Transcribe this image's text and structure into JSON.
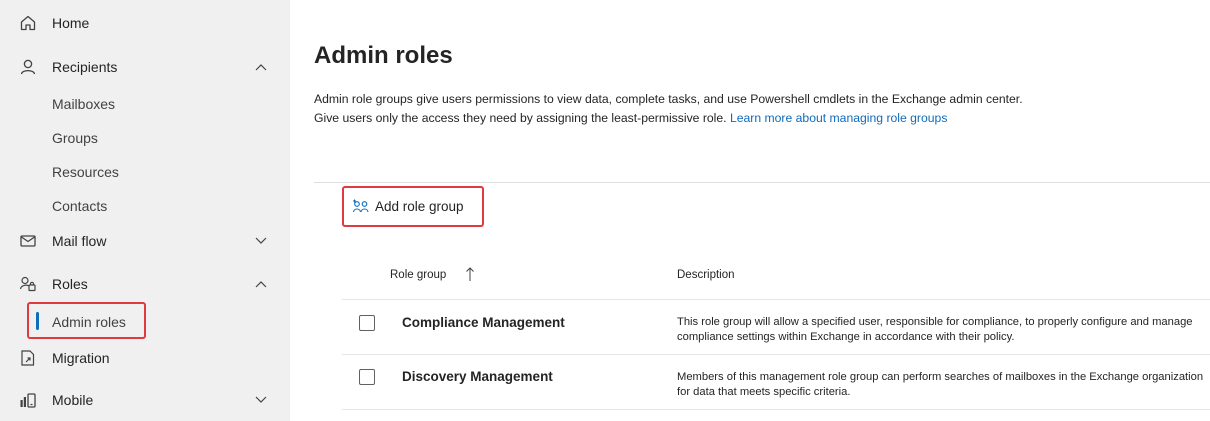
{
  "sidebar": {
    "items": [
      {
        "label": "Home",
        "icon": "home-icon"
      },
      {
        "label": "Recipients",
        "icon": "person-icon",
        "chevron": "up"
      },
      {
        "label": "Mailboxes"
      },
      {
        "label": "Groups"
      },
      {
        "label": "Resources"
      },
      {
        "label": "Contacts"
      },
      {
        "label": "Mail flow",
        "icon": "mail-icon",
        "chevron": "down"
      },
      {
        "label": "Roles",
        "icon": "roles-icon",
        "chevron": "up"
      },
      {
        "label": "Admin roles",
        "selected": true
      },
      {
        "label": "Migration",
        "icon": "migration-icon"
      },
      {
        "label": "Mobile",
        "icon": "mobile-icon",
        "chevron": "down"
      }
    ]
  },
  "main": {
    "title": "Admin roles",
    "description": "Admin role groups give users permissions to view data, complete tasks, and use Powershell cmdlets in the Exchange admin center. Give users only the access they need by assigning the least-permissive role. ",
    "description_link": "Learn more about managing role groups",
    "add_button_label": "Add role group",
    "table": {
      "columns": [
        "Role group",
        "Description"
      ],
      "sort": "ascending",
      "rows": [
        {
          "name": "Compliance Management",
          "description": "This role group will allow a specified user, responsible for compliance, to properly configure and manage compliance settings within Exchange in accordance with their policy."
        },
        {
          "name": "Discovery Management",
          "description": "Members of this management role group can perform searches of mailboxes in the Exchange organization for data that meets specific criteria."
        }
      ]
    }
  },
  "colors": {
    "accent": "#0f6cbd",
    "highlight": "#e0393e",
    "sidebar_bg": "#f0f0f0"
  }
}
